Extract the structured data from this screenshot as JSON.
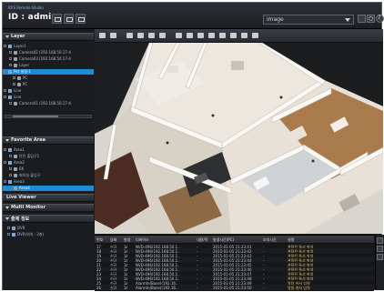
{
  "titlebar": {
    "app_name": "IDIS Remote Studio",
    "user_id": "ID : admin",
    "layout_select_value": "image"
  },
  "sidebar": {
    "layer_title": "Layer",
    "layer_rows": [
      {
        "indent": 4,
        "label": "Layer1",
        "icon": "folder-icon"
      },
      {
        "indent": 10,
        "label": "Camera02 (192.168.50.17-4",
        "icon": "camera-icon"
      },
      {
        "indent": 10,
        "label": "Camera03 (192.168.50.17-4",
        "icon": "camera-icon"
      },
      {
        "indent": 10,
        "label": "Layer",
        "icon": "camera-icon"
      },
      {
        "indent": 4,
        "label": "Pet 설정-1",
        "icon": "folder-icon",
        "selected": true
      },
      {
        "indent": 14,
        "label": "PC",
        "icon": "camera-icon"
      },
      {
        "indent": 14,
        "label": "PC",
        "icon": "camera-icon"
      },
      {
        "indent": 4,
        "label": "Line",
        "icon": "folder-icon"
      },
      {
        "indent": 4,
        "label": "Line",
        "icon": "folder-icon"
      },
      {
        "indent": 10,
        "label": "Camera01 (192.168.50.17-4",
        "icon": "camera-icon"
      }
    ],
    "favorite_title": "Favorite Area",
    "favorite_rows": [
      {
        "indent": 4,
        "label": "Area1",
        "icon": "folder-icon"
      },
      {
        "indent": 10,
        "label": "안전 출입구1",
        "icon": "camera-icon"
      },
      {
        "indent": 4,
        "label": "Area2",
        "icon": "folder-icon"
      },
      {
        "indent": 10,
        "label": "EK",
        "icon": "camera-icon"
      },
      {
        "indent": 10,
        "label": "회의실 출입구",
        "icon": "camera-icon"
      },
      {
        "indent": 4,
        "label": "Area3",
        "icon": "folder-icon"
      },
      {
        "indent": 10,
        "label": "Area4",
        "icon": "camera-icon",
        "selected": true
      }
    ],
    "live_viewer_title": "Live Viewer",
    "multi_monitor_title": "Multi Monitor",
    "event_title": "출제 정보",
    "event_rows": [
      {
        "indent": 8,
        "label": "DVR"
      },
      {
        "indent": 8,
        "label": "DVR(위치 : 2층)"
      }
    ]
  },
  "viewport": {
    "toolbar_icons": [
      "home-icon",
      "grid-icon",
      "arrow-icon",
      "hand-icon",
      "rotate-icon",
      "zoom-icon",
      "ruler-icon",
      "camera-add-icon",
      "camera-icon",
      "box-icon",
      "refresh-icon",
      "export-icon",
      "print-icon",
      "settings-icon"
    ]
  },
  "event_grid": {
    "columns": [
      "번호",
      "상태",
      "발생",
      "디바이스",
      "내용/적",
      "발생시간(PC)",
      "조치시간",
      "설명"
    ],
    "rows": [
      [
        "17",
        "신규",
        "1ℓ",
        "NVD-496(192.168.50.1..",
        "-",
        "2015-01-05 21:23:41",
        "-",
        "관찰된 특성 발생"
      ],
      [
        "18",
        "신규",
        "1ℓ",
        "NVD-496(192.168.50.1..",
        "-",
        "2015-01-05 21:23:42",
        "-",
        "관찰된 특성 발생"
      ],
      [
        "19",
        "신규",
        "1ℓ",
        "NVD-496(192.168.50.1..",
        "-",
        "2015-01-05 21:23:43",
        "-",
        "관찰된 특성 발생"
      ],
      [
        "20",
        "신규",
        "1ℓ",
        "NVD-496(192.168.50.1..",
        "-",
        "2015-01-05 21:23:44",
        "-",
        "관찰된 특성 발생"
      ],
      [
        "21",
        "신규",
        "1ℓ",
        "NVD-496(192.168.50.1..",
        "-",
        "2015-01-05 21:23:45",
        "-",
        "관찰된 특성 발생"
      ],
      [
        "22",
        "신규",
        "1ℓ",
        "NVD-496(192.168.50.1..",
        "-",
        "2015-01-05 21:23:46",
        "-",
        "관찰된 특성 발생"
      ],
      [
        "23",
        "신규",
        "1ℓ",
        "NVD-496(192.168.50.1..",
        "-",
        "2015-01-05 21:23:47",
        "-",
        "관찰된 특성 발생"
      ],
      [
        "24",
        "신규",
        "1ℓ",
        "NVD-496(192.168.50.1..",
        "-",
        "2015-01-05 21:23:48",
        "-",
        "관찰된 특성 발생"
      ],
      [
        "25",
        "신규",
        "1ℓ",
        "AlarmIn(Base)(192.16..",
        "-",
        "2015-01-05 21:23:49",
        "-",
        "알람 센서 입력"
      ],
      [
        "26",
        "신규",
        "1ℓ",
        "AlarmIn(Base)(192.16..",
        "-",
        "2015-01-05 21:23:50",
        "-",
        "알람 센서 입력"
      ]
    ]
  },
  "colors": {
    "accent": "#1f8ad6",
    "panel": "#1a1c1f"
  }
}
